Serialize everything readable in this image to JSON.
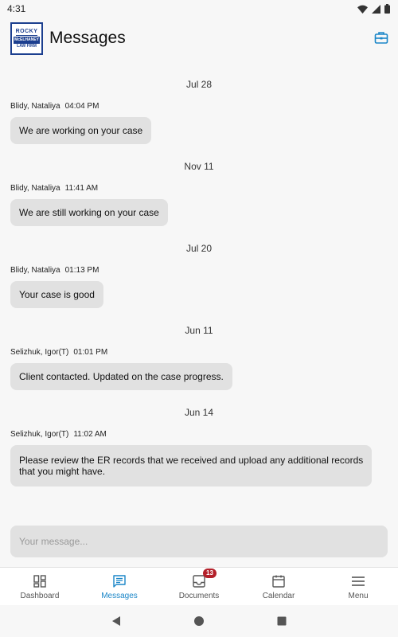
{
  "status_bar": {
    "time": "4:31"
  },
  "header": {
    "logo_lines": [
      "ROCKY",
      "McELHANEY",
      "LAW FIRM"
    ],
    "title": "Messages"
  },
  "messages": [
    {
      "date": "Jul 28",
      "author": "Blidy, Nataliya",
      "time": "04:04 PM",
      "text": "We are working on your case"
    },
    {
      "date": "Nov 11",
      "author": "Blidy, Nataliya",
      "time": "11:41 AM",
      "text": "We are still working on your case"
    },
    {
      "date": "Jul 20",
      "author": "Blidy, Nataliya",
      "time": "01:13 PM",
      "text": "Your case is good"
    },
    {
      "date": "Jun 11",
      "author": "Selizhuk, Igor(T)",
      "time": "01:01 PM",
      "text": "Client contacted. Updated on the case progress."
    },
    {
      "date": "Jun 14",
      "author": "Selizhuk, Igor(T)",
      "time": "11:02 AM",
      "text_line1": "Please review the ER records that we received and upload any additional records",
      "text_line2": "that you might have."
    }
  ],
  "composer": {
    "placeholder": "Your message..."
  },
  "nav": {
    "items": [
      {
        "label": "Dashboard",
        "icon": "dashboard-icon"
      },
      {
        "label": "Messages",
        "icon": "messages-icon",
        "active": true
      },
      {
        "label": "Documents",
        "icon": "documents-icon",
        "badge": "13"
      },
      {
        "label": "Calendar",
        "icon": "calendar-icon"
      },
      {
        "label": "Menu",
        "icon": "menu-icon"
      }
    ]
  },
  "colors": {
    "accent": "#1a86c8",
    "badge": "#b3202a",
    "bubble": "#e1e1e1",
    "logo": "#1c3f8f"
  }
}
